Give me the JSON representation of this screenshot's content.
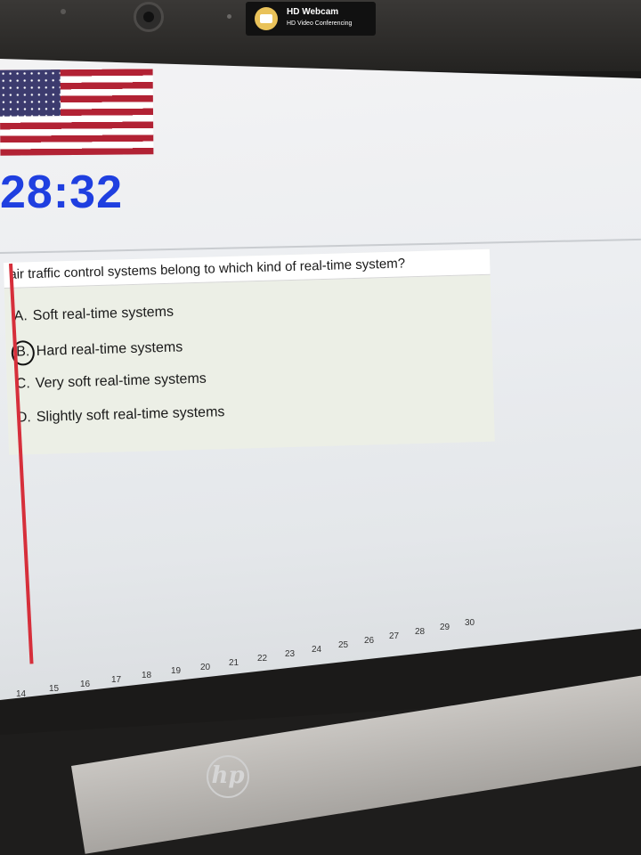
{
  "webcam": {
    "title": "HD Webcam",
    "subtitle": "HD Video Conferencing"
  },
  "timer": "28:32",
  "question": {
    "text": "air traffic control systems belong to which kind of real-time system?",
    "options": [
      {
        "letter": "A.",
        "label": "Soft real-time systems"
      },
      {
        "letter": "B.",
        "label": "Hard real-time systems"
      },
      {
        "letter": "C.",
        "label": "Very soft real-time systems"
      },
      {
        "letter": "D.",
        "label": "Slightly soft real-time systems"
      }
    ]
  },
  "question_nav": [
    "14",
    "15",
    "16",
    "17",
    "18",
    "19",
    "20",
    "21",
    "22",
    "23",
    "24",
    "25",
    "26",
    "27",
    "28",
    "29",
    "30"
  ],
  "brand": "hp"
}
